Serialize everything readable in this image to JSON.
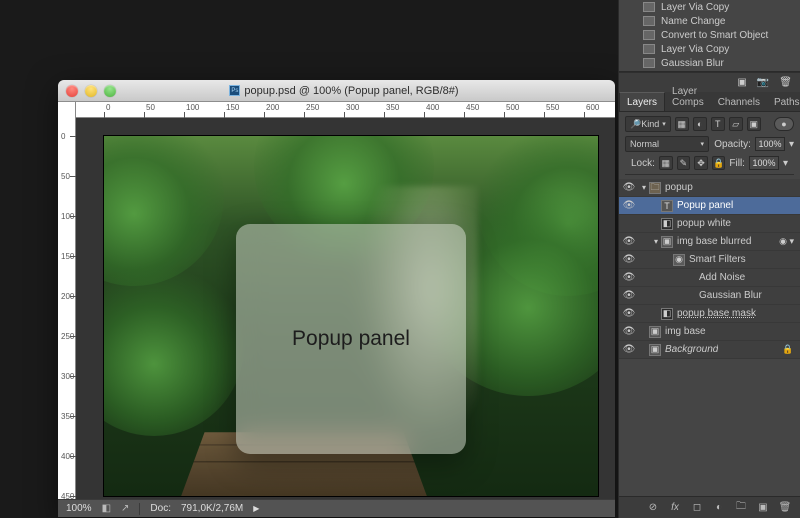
{
  "window": {
    "title": "popup.psd @ 100% (Popup panel, RGB/8#)",
    "traffic": {
      "close": "close",
      "minimize": "minimize",
      "zoom": "zoom"
    }
  },
  "ruler_h_ticks": [
    "0",
    "50",
    "100",
    "150",
    "200",
    "250",
    "300",
    "350",
    "400",
    "450",
    "500",
    "550",
    "600"
  ],
  "ruler_v_ticks": [
    "0",
    "50",
    "100",
    "150",
    "200",
    "250",
    "300",
    "350",
    "400",
    "450"
  ],
  "canvas": {
    "popup_text": "Popup panel"
  },
  "statusbar": {
    "zoom": "100%",
    "doc_info_label": "Doc:",
    "doc_info": "791,0K/2,76M"
  },
  "history": {
    "items": [
      {
        "label": "Layer Via Copy"
      },
      {
        "label": "Name Change"
      },
      {
        "label": "Convert to Smart Object"
      },
      {
        "label": "Layer Via Copy"
      },
      {
        "label": "Gaussian Blur"
      }
    ]
  },
  "layers_tabs": [
    "Layers",
    "Layer Comps",
    "Channels",
    "Paths"
  ],
  "layer_opts": {
    "kind_label": "Kind",
    "blend_mode": "Normal",
    "opacity_label": "Opacity:",
    "opacity_value": "100%",
    "lock_label": "Lock:",
    "fill_label": "Fill:",
    "fill_value": "100%"
  },
  "layers_tree": [
    {
      "eye": true,
      "depth": 0,
      "twisty": "down",
      "icon": "folder",
      "name": "popup"
    },
    {
      "eye": true,
      "depth": 1,
      "twisty": "",
      "icon": "text",
      "name": "Popup panel",
      "selected": true
    },
    {
      "eye": false,
      "depth": 1,
      "twisty": "",
      "icon": "mask",
      "name": "popup white"
    },
    {
      "eye": true,
      "depth": 1,
      "twisty": "down",
      "icon": "smart",
      "name": "img base blurred",
      "fx": true
    },
    {
      "eye": true,
      "depth": 2,
      "twisty": "",
      "icon": "fx",
      "name": "Smart Filters"
    },
    {
      "eye": true,
      "depth": 3,
      "twisty": "",
      "icon": "",
      "name": "Add Noise"
    },
    {
      "eye": true,
      "depth": 3,
      "twisty": "",
      "icon": "",
      "name": "Gaussian Blur"
    },
    {
      "eye": true,
      "depth": 1,
      "twisty": "",
      "icon": "mask",
      "name": "popup base mask",
      "underline": true
    },
    {
      "eye": true,
      "depth": 0,
      "twisty": "",
      "icon": "smart",
      "name": "img base"
    },
    {
      "eye": true,
      "depth": 0,
      "twisty": "",
      "icon": "smart",
      "name": "Background",
      "italic": true,
      "locked": true
    }
  ]
}
